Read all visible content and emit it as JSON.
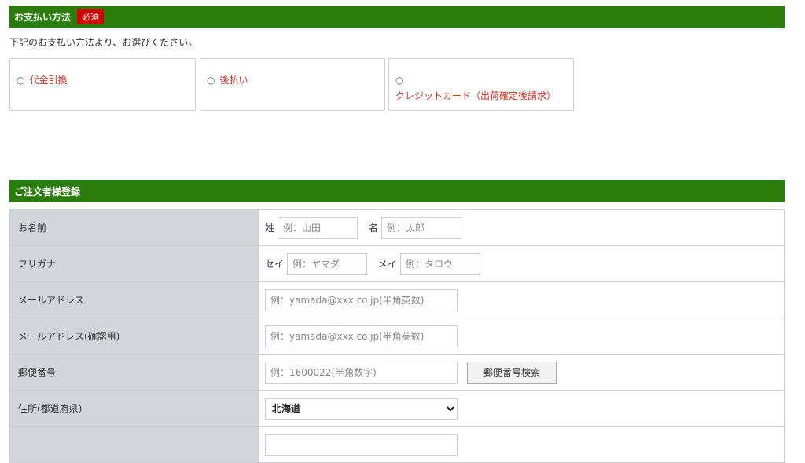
{
  "payment": {
    "title": "お支払い方法",
    "required_badge": "必須",
    "intro": "下記のお支払い方法より、お選びください。",
    "options": [
      {
        "radio": "○",
        "label": "代金引換"
      },
      {
        "radio": "○",
        "label": "後払い"
      },
      {
        "radio": "○",
        "label": "クレジットカード（出荷確定後請求）"
      }
    ]
  },
  "orderer": {
    "title": "ご注文者様登録",
    "rows": {
      "name": {
        "label": "お名前",
        "last_prefix": "姓",
        "last_placeholder": "例：山田",
        "first_prefix": "名",
        "first_placeholder": "例：太郎"
      },
      "kana": {
        "label": "フリガナ",
        "last_prefix": "セイ",
        "last_placeholder": "例：ヤマダ",
        "first_prefix": "メイ",
        "first_placeholder": "例：タロウ"
      },
      "email": {
        "label": "メールアドレス",
        "placeholder": "例：yamada@xxx.co.jp(半角英数)"
      },
      "email_confirm": {
        "label": "メールアドレス(確認用)",
        "placeholder": "例：yamada@xxx.co.jp(半角英数)"
      },
      "postal": {
        "label": "郵便番号",
        "placeholder": "例：1600022(半角数字)",
        "search_button": "郵便番号検索"
      },
      "prefecture": {
        "label": "住所(都道府県)",
        "selected": "北海道"
      }
    }
  },
  "colors": {
    "section_bar": "#2b7d0b",
    "required_badge": "#d40000",
    "option_text": "#c0392b",
    "label_bg": "#d2d6db"
  }
}
